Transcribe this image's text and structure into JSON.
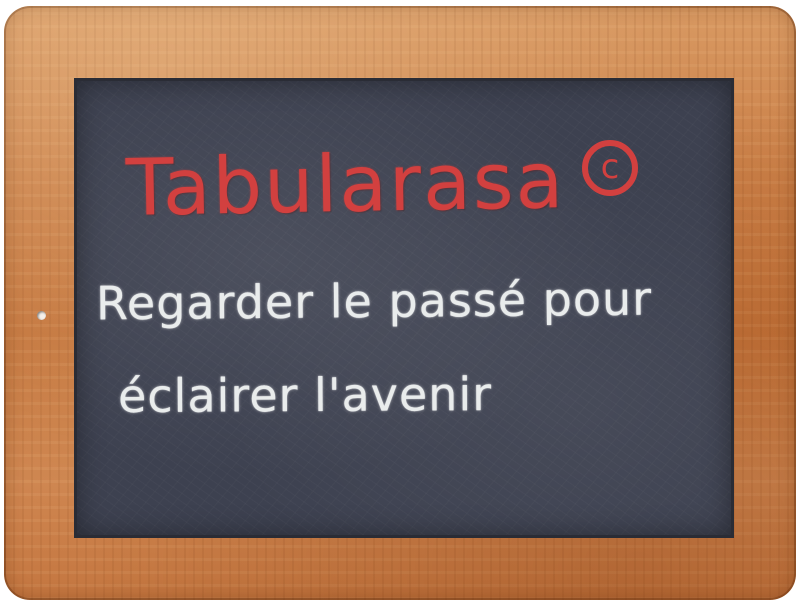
{
  "slate": {
    "brand": "Tabularasa",
    "copyright_symbol": "c",
    "tagline_line1": "Regarder le passé pour",
    "tagline_line2": "éclairer l'avenir"
  },
  "colors": {
    "frame_wood": "#c97d45",
    "board": "#3d4150",
    "chalk_red": "#d2403f",
    "chalk_white": "#e9ecec"
  }
}
